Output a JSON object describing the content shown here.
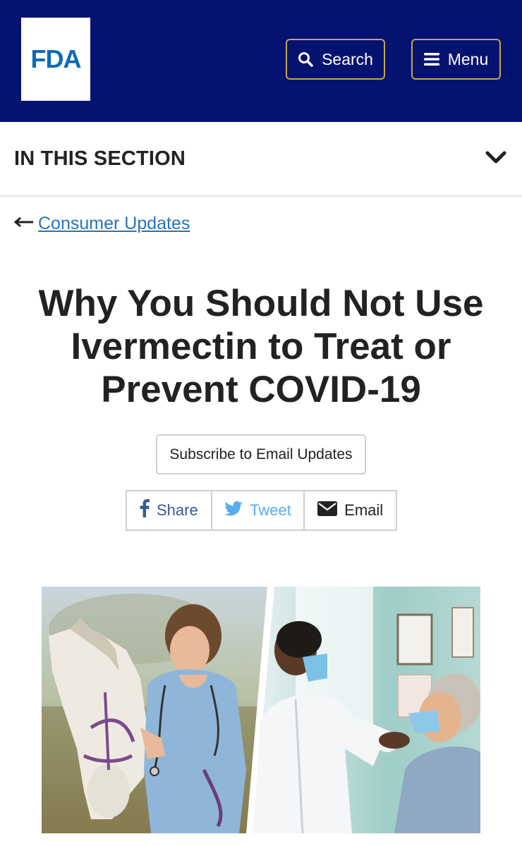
{
  "header": {
    "logo_text": "FDA",
    "search_label": "Search",
    "menu_label": "Menu",
    "colors": {
      "background": "#051370",
      "button_border": "#c8a34a",
      "logo": "#0d6bb7"
    }
  },
  "section_nav": {
    "title": "IN THIS SECTION",
    "icon": "chevron-down-icon"
  },
  "breadcrumb": {
    "icon": "arrow-left-icon",
    "label": "Consumer Updates"
  },
  "article": {
    "title": "Why You Should Not Use Ivermectin to Treat or Prevent COVID-19",
    "subscribe_label": "Subscribe to Email Updates",
    "share": [
      {
        "label": "Share",
        "icon": "facebook-icon",
        "color": "#3b5998"
      },
      {
        "label": "Tweet",
        "icon": "twitter-icon",
        "color": "#55acee"
      },
      {
        "label": "Email",
        "icon": "envelope-icon",
        "color": "#222222"
      }
    ],
    "hero_image": {
      "panels": [
        "veterinarian-with-horse",
        "doctor-examining-patient"
      ]
    }
  },
  "colors": {
    "link": "#2a73b4",
    "text": "#222222",
    "border": "#cfcfcf"
  }
}
